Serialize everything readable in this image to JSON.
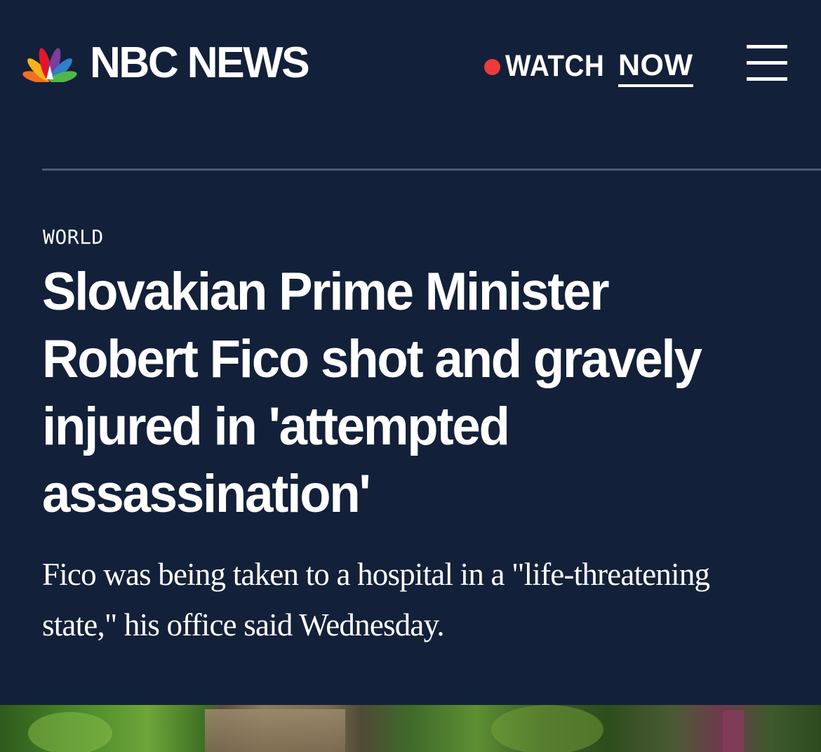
{
  "header": {
    "logo_text": "NBC NEWS",
    "logo_icon": "nbc-peacock-icon",
    "watch_label": "WATCH",
    "watch_now_label": "NOW",
    "live_dot_color": "#ef3b3b",
    "menu_icon": "hamburger-menu-icon"
  },
  "article": {
    "section": "WORLD",
    "headline": "Slovakian Prime Minister Robert Fico shot and gravely injured in 'attempted assassination'",
    "dek": "Fico was being taken to a hospital in a \"life-threatening state,\" his office said Wednesday."
  },
  "colors": {
    "background": "#132039",
    "divider": "#4b5a76",
    "text": "#ffffff"
  }
}
